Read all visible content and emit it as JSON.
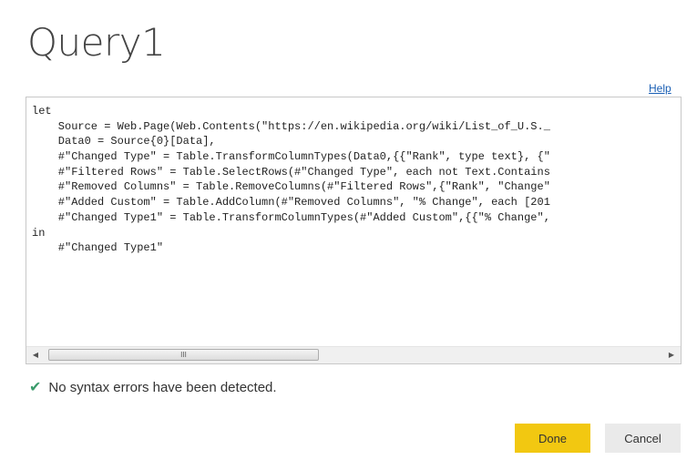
{
  "title": "Query1",
  "help_label": "Help",
  "code_lines": [
    "let",
    "    Source = Web.Page(Web.Contents(\"https://en.wikipedia.org/wiki/List_of_U.S._",
    "    Data0 = Source{0}[Data],",
    "    #\"Changed Type\" = Table.TransformColumnTypes(Data0,{{\"Rank\", type text}, {\"",
    "    #\"Filtered Rows\" = Table.SelectRows(#\"Changed Type\", each not Text.Contains",
    "    #\"Removed Columns\" = Table.RemoveColumns(#\"Filtered Rows\",{\"Rank\", \"Change\"",
    "    #\"Added Custom\" = Table.AddColumn(#\"Removed Columns\", \"% Change\", each [201",
    "    #\"Changed Type1\" = Table.TransformColumnTypes(#\"Added Custom\",{{\"% Change\",",
    "in",
    "    #\"Changed Type1\""
  ],
  "scrollbar": {
    "left_arrow": "◀",
    "right_arrow": "▶",
    "thumb_grip": "III"
  },
  "status": {
    "icon": "check-icon",
    "text": "No syntax errors have been detected.",
    "color": "#3a9b6b"
  },
  "buttons": {
    "done": "Done",
    "cancel": "Cancel"
  },
  "colors": {
    "accent": "#f2c811",
    "link": "#1a5fb4"
  }
}
